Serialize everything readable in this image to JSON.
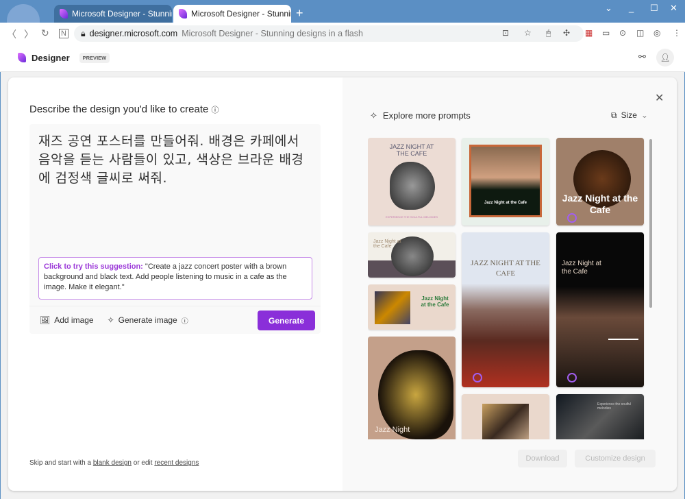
{
  "browser": {
    "tabs": [
      {
        "label": "Microsoft Designer - Stunning d",
        "active": false
      },
      {
        "label": "Microsoft Designer - Stunning d",
        "active": true
      }
    ],
    "url_host": "designer.microsoft.com",
    "url_title": "Microsoft Designer - Stunning designs in a flash"
  },
  "app": {
    "brand": "Designer",
    "badge": "PREVIEW"
  },
  "left": {
    "heading": "Describe the design you'd like to create",
    "prompt_value": "재즈 공연 포스터를 만들어줘. 배경은 카페에서 음악을 듣는 사람들이 있고, 색상은 브라운 배경에 검정색 글씨로 써줘.",
    "suggestion_label": "Click to try this suggestion:",
    "suggestion_text": " \"Create a jazz concert poster with a brown background and black text. Add people listening to music in a cafe as the image. Make it elegant.\"",
    "add_image": "Add image",
    "generate_image": "Generate image",
    "generate": "Generate",
    "footer": {
      "prefix": "Skip and start with a ",
      "blank": "blank design",
      "middle": " or edit ",
      "recent": "recent designs"
    }
  },
  "right": {
    "explore": "Explore more prompts",
    "size": "Size",
    "download": "Download",
    "customize": "Customize design",
    "thumbs": [
      {
        "title": "JAZZ NIGHT AT THE CAFE",
        "sub": "EXPERIENCE THE SOULFUL MELODIES"
      },
      {
        "title": "Jazz Night at the Cafe"
      },
      {
        "title": "Jazz Night at the Cafe"
      },
      {
        "title": "Jazz Night at the Cafe"
      },
      {
        "title": "Jazz Night at the Cafe"
      },
      {
        "title": "Jazz Night"
      },
      {
        "title": "JAZZ NIGHT AT THE CAFE"
      },
      {
        "title": "Jazz Night at the Cafe"
      },
      {
        "title": "Experience the soulful melodies"
      }
    ]
  },
  "colors": {
    "accent": "#8a2fd9",
    "suggestion_border": "#c58ae8",
    "window": "#5b8fc4"
  }
}
